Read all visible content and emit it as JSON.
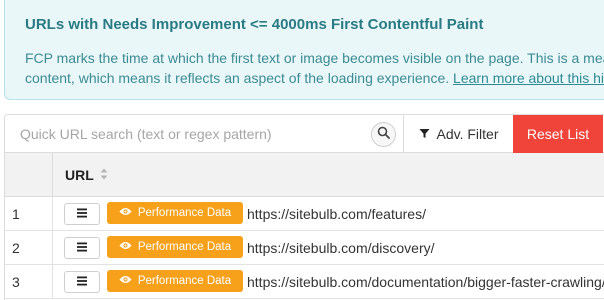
{
  "hint": {
    "title": "URLs with Needs Improvement <= 4000ms First Contentful Paint",
    "text_line1": "FCP marks the time at which the first text or image becomes visible on the page. This is a measure of",
    "text_line2": "content, which means it reflects an aspect of the loading experience. ",
    "link_label": "Learn more about this hint"
  },
  "toolbar": {
    "search_placeholder": "Quick URL search (text or regex pattern)",
    "adv_filter_label": "Adv. Filter",
    "reset_label": "Reset List"
  },
  "table": {
    "url_header": "URL",
    "rows": [
      {
        "index": "1",
        "perf_label": "Performance Data",
        "url": "https://sitebulb.com/features/"
      },
      {
        "index": "2",
        "perf_label": "Performance Data",
        "url": "https://sitebulb.com/discovery/"
      },
      {
        "index": "3",
        "perf_label": "Performance Data",
        "url": "https://sitebulb.com/documentation/bigger-faster-crawling/"
      }
    ]
  },
  "colors": {
    "hint_bg": "#e9f7f8",
    "hint_text": "#2a7a84",
    "reset_bg": "#f0433a",
    "perf_bg": "#f7a01a"
  },
  "icons": [
    "search-icon",
    "filter-icon",
    "sort-icon",
    "hamburger-icon",
    "eye-icon"
  ]
}
